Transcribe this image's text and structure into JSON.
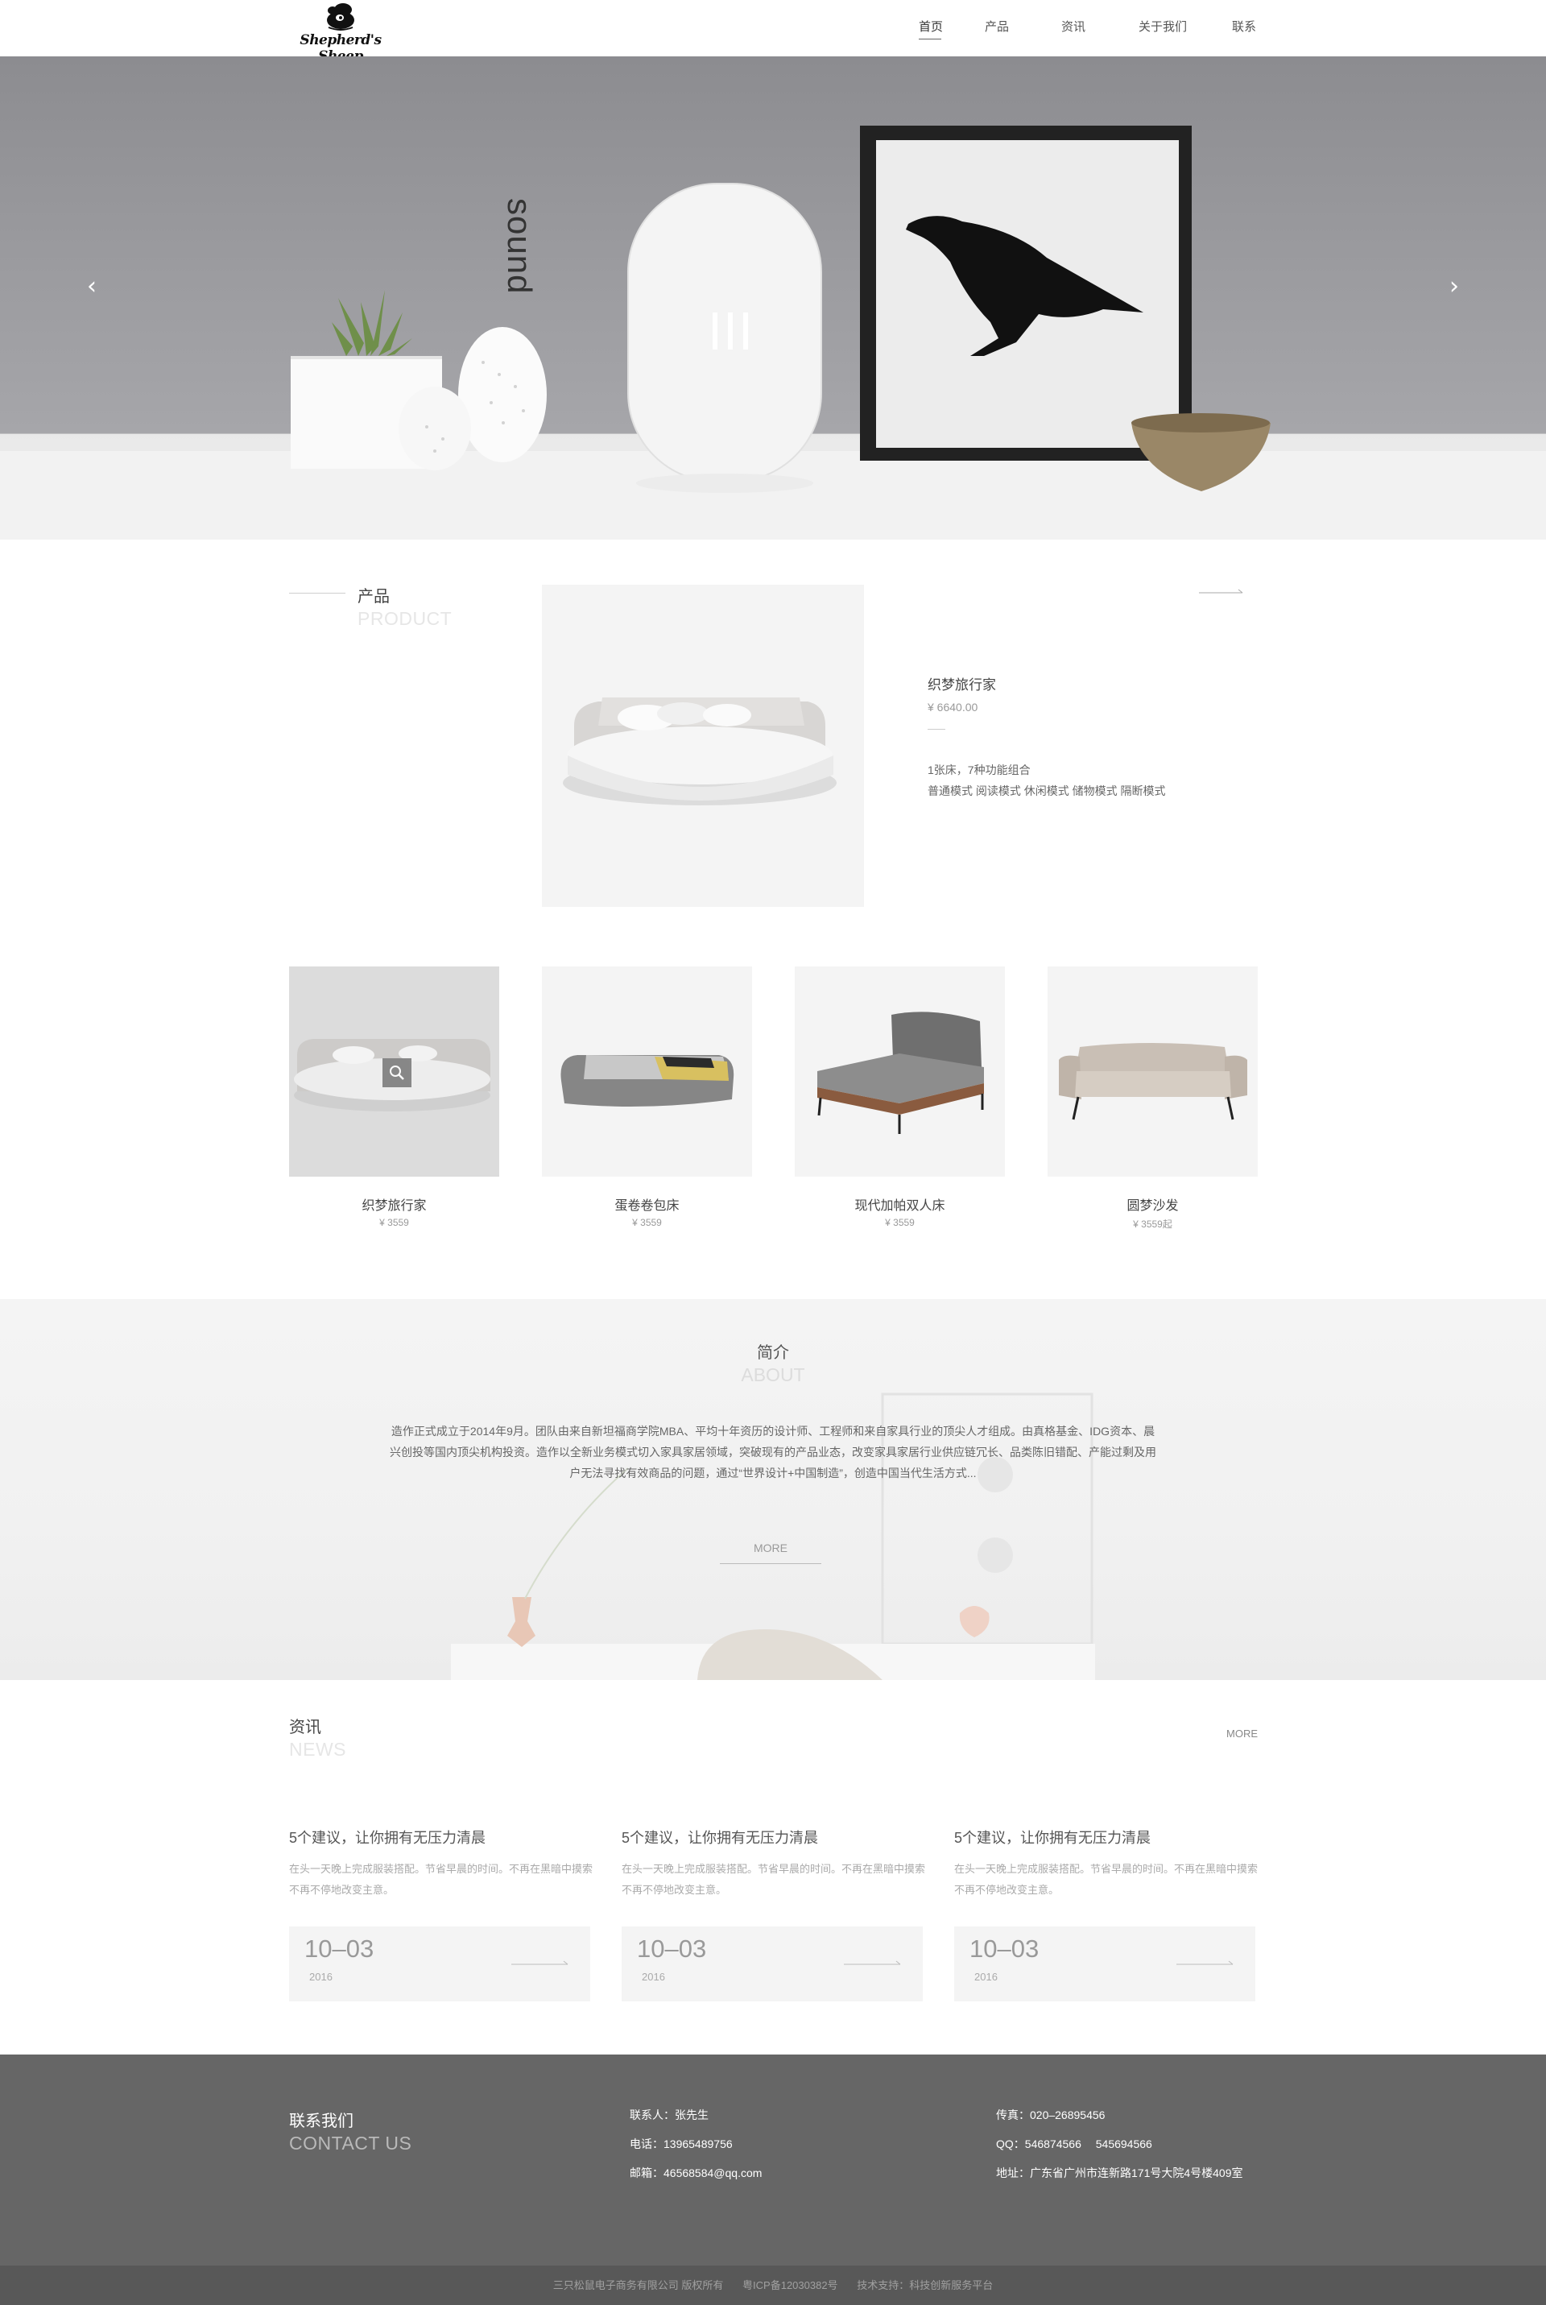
{
  "header": {
    "logo_text": "Shepherd's Sheep",
    "nav": [
      "首页",
      "产品",
      "资讯",
      "关于我们",
      "联系"
    ],
    "active_index": 0
  },
  "hero": {
    "vertical_text": "sound",
    "prev_icon": "chevron-left-icon",
    "next_icon": "chevron-right-icon"
  },
  "product_section": {
    "title": "产品",
    "subtitle": "PRODUCT",
    "featured": {
      "name": "织梦旅行家",
      "price": "¥ 6640.00",
      "desc_line1": "1张床，7种功能组合",
      "desc_line2": "普通模式 阅读模式 休闲模式 储物模式 隔断模式"
    },
    "items": [
      {
        "name": "织梦旅行家",
        "price": "¥ 3559"
      },
      {
        "name": "蛋卷卷包床",
        "price": "¥ 3559"
      },
      {
        "name": "现代加帕双人床",
        "price": "¥ 3559"
      },
      {
        "name": "圆梦沙发",
        "price": "¥ 3559起"
      }
    ]
  },
  "about": {
    "title": "简介",
    "subtitle": "ABOUT",
    "text": "造作正式成立于2014年9月。团队由来自新坦福商学院MBA、平均十年资历的设计师、工程师和来自家具行业的顶尖人才组成。由真格基金、IDG资本、晨兴创投等国内顶尖机构投资。造作以全新业务模式切入家具家居领域，突破现有的产品业态，改变家具家居行业供应链冗长、品类陈旧错配、产能过剩及用户无法寻找有效商品的问题，通过“世界设计+中国制造”，创造中国当代生活方式...",
    "more": "MORE"
  },
  "news": {
    "title": "资讯",
    "subtitle": "NEWS",
    "more": "MORE",
    "items": [
      {
        "title": "5个建议，让你拥有无压力清晨",
        "text": "在头一天晚上完成服装搭配。节省早晨的时间。不再在黑暗中摸索不再不停地改变主意。",
        "date": "10–03",
        "year": "2016"
      },
      {
        "title": "5个建议，让你拥有无压力清晨",
        "text": "在头一天晚上完成服装搭配。节省早晨的时间。不再在黑暗中摸索不再不停地改变主意。",
        "date": "10–03",
        "year": "2016"
      },
      {
        "title": "5个建议，让你拥有无压力清晨",
        "text": "在头一天晚上完成服装搭配。节省早晨的时间。不再在黑暗中摸索不再不停地改变主意。",
        "date": "10–03",
        "year": "2016"
      }
    ]
  },
  "footer": {
    "title": "联系我们",
    "subtitle": "CONTACT US",
    "contact_person": "联系人：张先生",
    "phone": "电话：13965489756",
    "email": "邮箱：46568584@qq.com",
    "fax": "传真：020–26895456",
    "qq": "QQ：546874566　 545694566",
    "address": "地址：广东省广州市连新路171号大院4号楼409室"
  },
  "copyright": {
    "company": "三只松鼠电子商务有限公司 版权所有",
    "icp": "粤ICP备12030382号",
    "support": "技术支持：科技创新服务平台"
  },
  "colors": {
    "footer_bg": "#666666",
    "copyright_bg": "#585858",
    "about_bg": "#f2f2f2",
    "card_bg": "#f4f4f4"
  }
}
